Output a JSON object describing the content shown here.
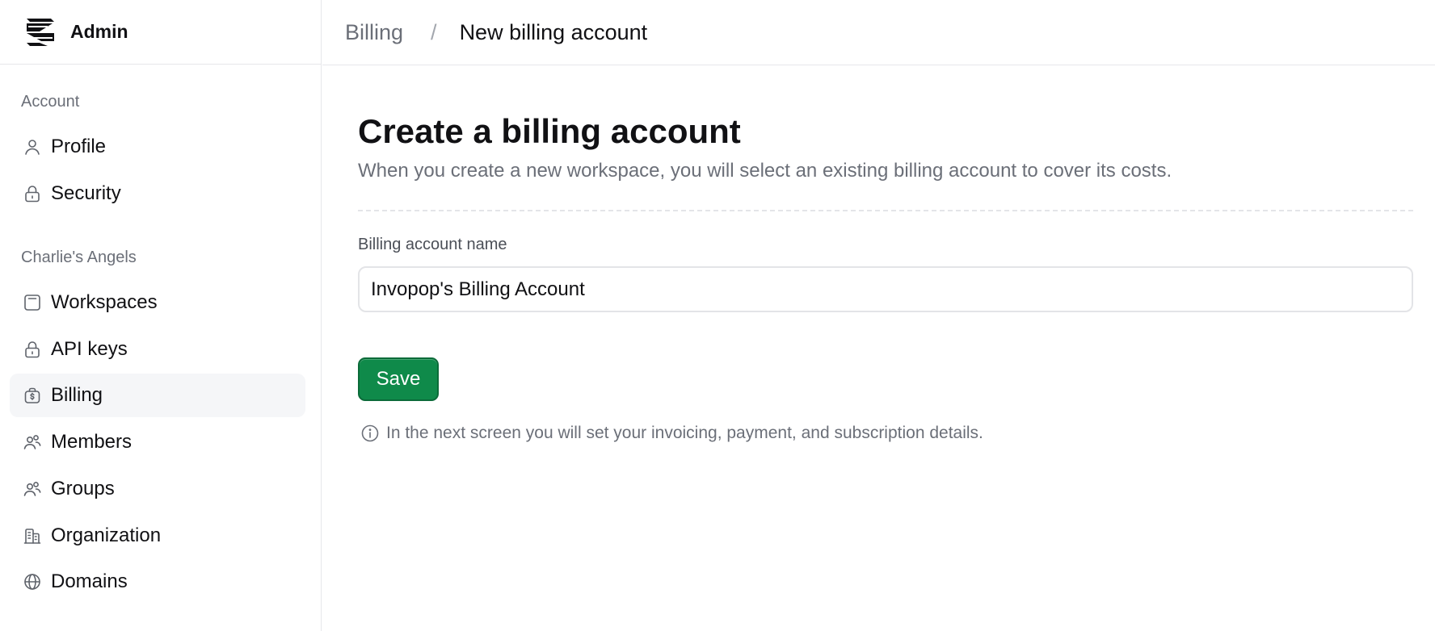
{
  "app": {
    "name": "Admin"
  },
  "breadcrumb": {
    "parent": "Billing",
    "separator": "/",
    "current": "New billing account"
  },
  "sidebar": {
    "sections": [
      {
        "title": "Account",
        "items": [
          {
            "label": "Profile",
            "icon": "user-icon",
            "active": false
          },
          {
            "label": "Security",
            "icon": "lock-icon",
            "active": false
          }
        ]
      },
      {
        "title": "Charlie's Angels",
        "items": [
          {
            "label": "Workspaces",
            "icon": "workspace-icon",
            "active": false
          },
          {
            "label": "API keys",
            "icon": "lock-icon",
            "active": false
          },
          {
            "label": "Billing",
            "icon": "billing-icon",
            "active": true
          },
          {
            "label": "Members",
            "icon": "users-icon",
            "active": false
          },
          {
            "label": "Groups",
            "icon": "users-icon",
            "active": false
          },
          {
            "label": "Organization",
            "icon": "building-icon",
            "active": false
          },
          {
            "label": "Domains",
            "icon": "globe-icon",
            "active": false
          }
        ]
      }
    ]
  },
  "main": {
    "title": "Create a billing account",
    "subtitle": "When you create a new workspace, you will select an existing billing account to cover its costs.",
    "form": {
      "name_label": "Billing account name",
      "name_value": "Invopop's Billing Account",
      "save_label": "Save"
    },
    "hint": "In the next screen you will set your invoicing, payment, and subscription details."
  },
  "colors": {
    "accent": "#0f8a4a",
    "active_nav_bg": "#f5f6f8",
    "muted_text": "#6b6f78",
    "border": "#e6e7ea"
  }
}
